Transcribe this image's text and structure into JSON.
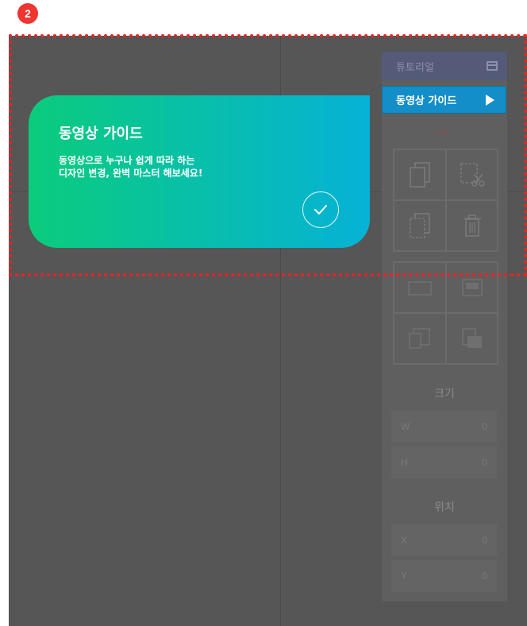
{
  "step": {
    "number": "2"
  },
  "panel": {
    "title": "튜토리얼",
    "size_label": "크기",
    "position_label": "위치",
    "fields": [
      {
        "label": "W",
        "value": "0"
      },
      {
        "label": "H",
        "value": "0"
      },
      {
        "label": "X",
        "value": "0"
      },
      {
        "label": "Y",
        "value": "0"
      }
    ]
  },
  "video_guide_button": {
    "label": "동영상 가이드"
  },
  "guide_card": {
    "title": "동영상 가이드",
    "desc_line1": "동영상으로 누구나 쉽게 따라 하는",
    "desc_line2": "디자인 변경, 완벽 마스터 해보세요!"
  },
  "colors": {
    "badge": "#ee3530",
    "highlight_border": "#ee2222",
    "card_gradient_start": "#0bcc7c",
    "card_gradient_end": "#06b2d6",
    "video_button": "#138ec9",
    "canvas": "#565656"
  },
  "icons": [
    "layout-icon",
    "copy-icon",
    "cut-icon",
    "paste-icon",
    "trash-icon",
    "align-icon",
    "check-icon",
    "play-icon"
  ]
}
